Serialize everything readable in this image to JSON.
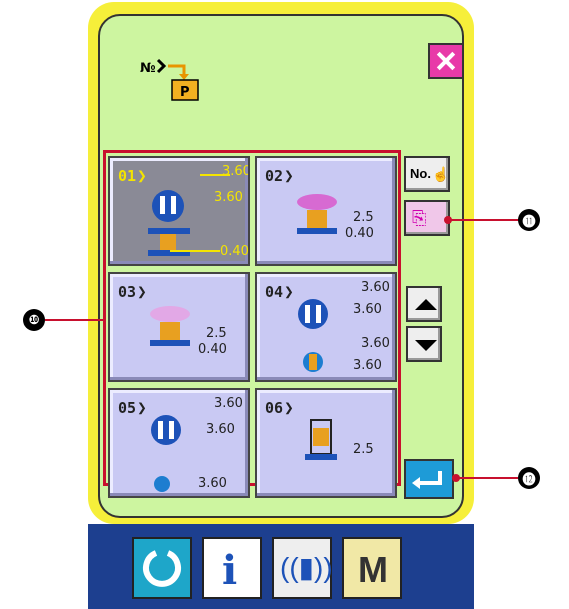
{
  "header": {
    "no_label": "No."
  },
  "patterns": [
    {
      "num": "01",
      "values": [
        "3.60",
        "3.60",
        "0.40"
      ],
      "selected": true
    },
    {
      "num": "02",
      "values": [
        "2.5",
        "0.40"
      ]
    },
    {
      "num": "03",
      "values": [
        "2.5",
        "0.40"
      ]
    },
    {
      "num": "04",
      "values": [
        "3.60",
        "3.60",
        "3.60",
        "3.60"
      ]
    },
    {
      "num": "05",
      "values": [
        "3.60",
        "3.60",
        "3.60"
      ]
    },
    {
      "num": "06",
      "values": [
        "2.5"
      ]
    }
  ],
  "callouts": {
    "c10": "❿",
    "c11": "⓫",
    "c12": "⓬"
  },
  "bottom": {
    "info": "i",
    "mode": "M"
  },
  "colors": {
    "panel": "#cdf5a0",
    "frame": "#f6ef3a",
    "selected": "#8a8a96",
    "button": "#c9c9f3",
    "accent": "#e83aa8"
  }
}
